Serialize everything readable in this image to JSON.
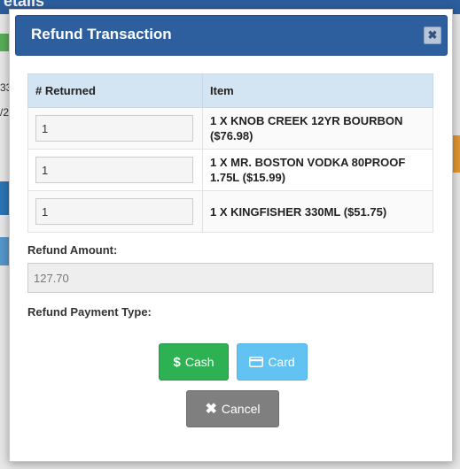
{
  "background": {
    "header_fragment": "etails",
    "fragments": [
      "33",
      "/2"
    ]
  },
  "modal": {
    "title": "Refund Transaction",
    "close_glyph": "✖"
  },
  "table": {
    "headers": [
      "# Returned",
      "Item"
    ],
    "rows": [
      {
        "returned": "1",
        "item": "1 X KNOB CREEK 12YR BOURBON ($76.98)"
      },
      {
        "returned": "1",
        "item": "1 X MR. BOSTON VODKA 80PROOF 1.75L ($15.99)"
      },
      {
        "returned": "1",
        "item": "1 X KINGFISHER 330ML ($51.75)"
      }
    ]
  },
  "refund_amount": {
    "label": "Refund Amount:",
    "value": "127.70"
  },
  "refund_payment_type": {
    "label": "Refund Payment Type:"
  },
  "buttons": {
    "cash": {
      "label": "Cash",
      "icon": "dollar-icon",
      "color": "#2eb152"
    },
    "card": {
      "label": "Card",
      "icon": "credit-card-icon",
      "color": "#62c2f1"
    },
    "cancel": {
      "label": "Cancel",
      "icon": "times-icon",
      "color": "#7f7f7f"
    }
  },
  "colors": {
    "header": "#2d5f9f",
    "table_header": "#d3e5f3"
  }
}
